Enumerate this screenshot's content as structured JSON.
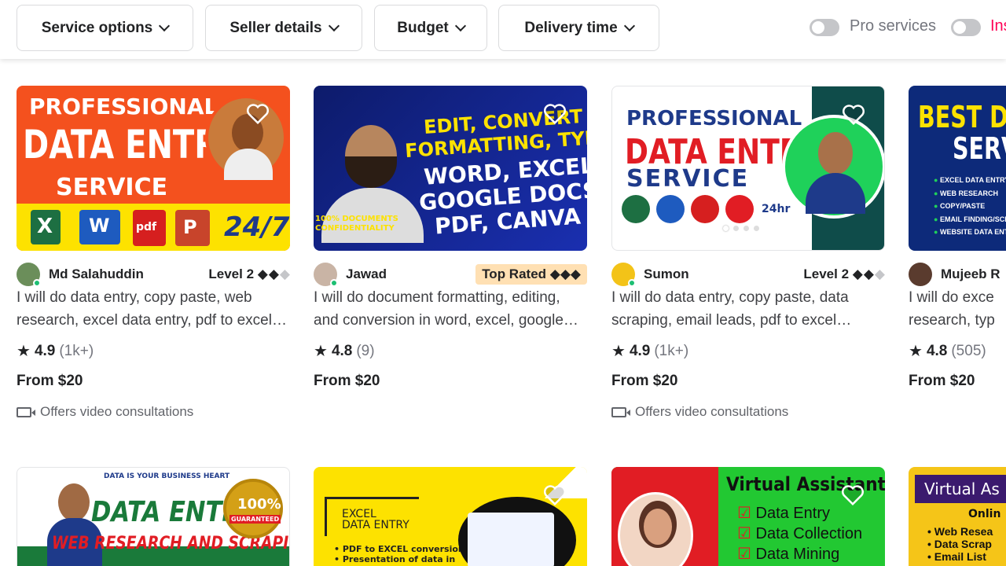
{
  "filters": {
    "service_options": "Service options",
    "seller_details": "Seller details",
    "budget": "Budget",
    "delivery_time": "Delivery time"
  },
  "toggles": {
    "pro_services": "Pro services",
    "instant": "Ins"
  },
  "gigs": [
    {
      "seller": "Md Salahuddin",
      "level": "Level 2",
      "title": "I will do data entry, copy paste, web research, excel data entry, pdf to excel conversion",
      "score": "4.9",
      "count": "(1k+)",
      "price": "From $20",
      "video": "Offers video consultations",
      "thumb": {
        "line1": "PROFESSIONAL",
        "line2": "DATA ENTRY",
        "line3": "SERVICE",
        "badge": "24/7"
      }
    },
    {
      "seller": "Jawad",
      "badge": "Top Rated",
      "title": "I will do document formatting, editing, and conversion in word, excel, google docs",
      "score": "4.8",
      "count": "(9)",
      "price": "From $20",
      "thumb": {
        "line1": "EDIT, CONVERT",
        "line2": "FORMATTING, TYPE",
        "line3": "WORD, EXCEL,",
        "line4": "GOOGLE DOCS,",
        "line5": "PDF, CANVA",
        "corner": "100% DOCUMENTS CONFIDENTIALITY"
      }
    },
    {
      "seller": "Sumon",
      "level": "Level 2",
      "title": "I will do data entry, copy paste, data scraping, email leads, pdf to excel conversion",
      "score": "4.9",
      "count": "(1k+)",
      "price": "From $20",
      "video": "Offers video consultations",
      "thumb": {
        "line1": "PROFESSIONAL",
        "line2": "DATA ENTRY",
        "line3": "SERVICE",
        "badge": "24hr"
      }
    },
    {
      "seller": "Mujeeb R",
      "title": "I will do excel data entry, web research, typing",
      "score": "4.8",
      "count": "(505)",
      "price": "From $20",
      "thumb": {
        "line1": "BEST DATA",
        "line2": "SERVI",
        "items": [
          "EXCEL DATA ENTRY",
          "WEB RESEARCH",
          "COPY/PASTE",
          "EMAIL FINDING/SCRA",
          "WEBSITE DATA ENTRY"
        ]
      }
    }
  ],
  "row2": [
    {
      "top": "DATA IS YOUR BUSINESS HEART",
      "main": "DATA ENTRY",
      "sub": "WEB RESEARCH AND SCRAPING",
      "seal": "100%",
      "seal2": "GUARANTEED"
    },
    {
      "main1": "EXCEL",
      "main2": "DATA ENTRY",
      "b1": "• PDF to EXCEL conversion",
      "b2": "• Presentation of data in"
    },
    {
      "title": "Virtual Assistant",
      "items": [
        "Data Entry",
        "Data Collection",
        "Data Mining"
      ]
    },
    {
      "title": "Virtual As",
      "sub": "Onlin",
      "items": [
        "• Web Resea",
        "• Data Scrap",
        "• Email List"
      ]
    }
  ]
}
